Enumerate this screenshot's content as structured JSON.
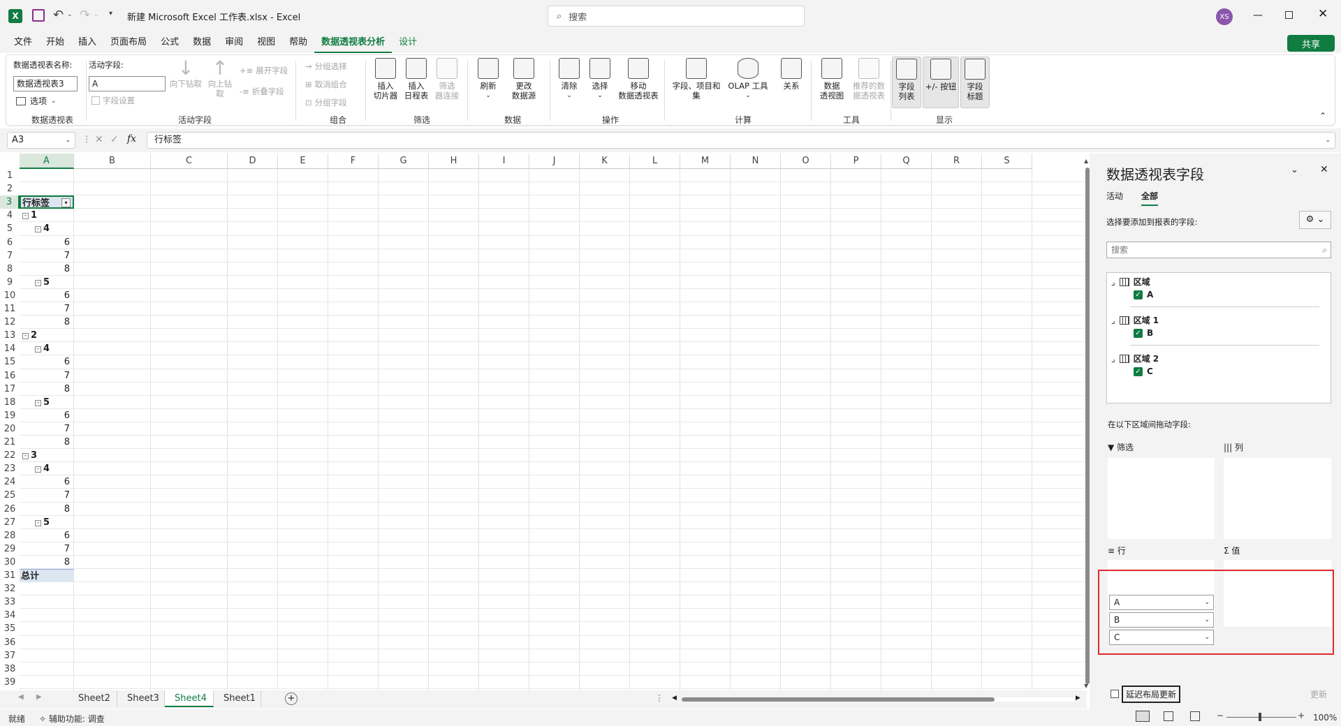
{
  "titlebar": {
    "doc_title": "新建 Microsoft Excel 工作表.xlsx  -  Excel",
    "search_placeholder": "搜索",
    "avatar": "XS"
  },
  "menu": {
    "items": [
      "文件",
      "开始",
      "插入",
      "页面布局",
      "公式",
      "数据",
      "审阅",
      "视图",
      "帮助",
      "数据透视表分析",
      "设计"
    ],
    "active": "数据透视表分析",
    "share": "共享"
  },
  "ribbon": {
    "pt_name_label": "数据透视表名称:",
    "pt_name_value": "数据透视表3",
    "options": "选项",
    "group_pivot": "数据透视表",
    "active_field_label": "活动字段:",
    "active_field_value": "A",
    "field_settings": "字段设置",
    "drill_down": "向下钻取",
    "drill_up": "向上钻\n取",
    "expand_field": "展开字段",
    "collapse_field": "折叠字段",
    "group_active": "活动字段",
    "group_selection": "分组选择",
    "ungroup": "取消组合",
    "group_field": "分组字段",
    "group_group": "组合",
    "insert_slicer": "插入\n切片器",
    "insert_timeline": "插入\n日程表",
    "filter_conn": "筛选\n器连接",
    "group_filter": "筛选",
    "refresh": "刷新",
    "change_source": "更改\n数据源",
    "group_data": "数据",
    "clear": "清除",
    "select": "选择",
    "move_pt": "移动\n数据透视表",
    "group_actions": "操作",
    "fields_items": "字段、项目和\n集",
    "olap": "OLAP 工具",
    "relations": "关系",
    "group_calc": "计算",
    "pivot_chart": "数据\n透视图",
    "recommended": "推荐的数\n据透视表",
    "group_tools": "工具",
    "field_list": "字段\n列表",
    "plus_minus": "+/- 按钮",
    "field_headers": "字段\n标题",
    "group_show": "显示"
  },
  "formula_bar": {
    "name_box": "A3",
    "fx": "fx",
    "content": "行标签"
  },
  "grid": {
    "columns": [
      "A",
      "B",
      "C",
      "D",
      "E",
      "F",
      "G",
      "H",
      "I",
      "J",
      "K",
      "L",
      "M",
      "N",
      "O",
      "P",
      "Q",
      "R",
      "S"
    ],
    "rows": [
      "1",
      "2",
      "3",
      "4",
      "5",
      "6",
      "7",
      "8",
      "9",
      "10",
      "11",
      "12",
      "13",
      "14",
      "15",
      "16",
      "17",
      "18",
      "19",
      "20",
      "21",
      "22",
      "23",
      "24",
      "25",
      "26",
      "27",
      "28",
      "29",
      "30",
      "31",
      "32",
      "33",
      "34",
      "35",
      "36",
      "37",
      "38",
      "39"
    ],
    "header_cell": "行标签",
    "total_cell": "总计",
    "pivot": [
      {
        "row": 4,
        "level": 0,
        "text": "1"
      },
      {
        "row": 5,
        "level": 1,
        "text": "4"
      },
      {
        "row": 6,
        "level": 2,
        "text": "6"
      },
      {
        "row": 7,
        "level": 2,
        "text": "7"
      },
      {
        "row": 8,
        "level": 2,
        "text": "8"
      },
      {
        "row": 9,
        "level": 1,
        "text": "5"
      },
      {
        "row": 10,
        "level": 2,
        "text": "6"
      },
      {
        "row": 11,
        "level": 2,
        "text": "7"
      },
      {
        "row": 12,
        "level": 2,
        "text": "8"
      },
      {
        "row": 13,
        "level": 0,
        "text": "2"
      },
      {
        "row": 14,
        "level": 1,
        "text": "4"
      },
      {
        "row": 15,
        "level": 2,
        "text": "6"
      },
      {
        "row": 16,
        "level": 2,
        "text": "7"
      },
      {
        "row": 17,
        "level": 2,
        "text": "8"
      },
      {
        "row": 18,
        "level": 1,
        "text": "5"
      },
      {
        "row": 19,
        "level": 2,
        "text": "6"
      },
      {
        "row": 20,
        "level": 2,
        "text": "7"
      },
      {
        "row": 21,
        "level": 2,
        "text": "8"
      },
      {
        "row": 22,
        "level": 0,
        "text": "3"
      },
      {
        "row": 23,
        "level": 1,
        "text": "4"
      },
      {
        "row": 24,
        "level": 2,
        "text": "6"
      },
      {
        "row": 25,
        "level": 2,
        "text": "7"
      },
      {
        "row": 26,
        "level": 2,
        "text": "8"
      },
      {
        "row": 27,
        "level": 1,
        "text": "5"
      },
      {
        "row": 28,
        "level": 2,
        "text": "6"
      },
      {
        "row": 29,
        "level": 2,
        "text": "7"
      },
      {
        "row": 30,
        "level": 2,
        "text": "8"
      }
    ]
  },
  "sheets": {
    "tabs": [
      "Sheet2",
      "Sheet3",
      "Sheet4",
      "Sheet1"
    ],
    "active": "Sheet4"
  },
  "status": {
    "ready": "就绪",
    "accessibility": "辅助功能: 调查",
    "zoom": "100%"
  },
  "panel": {
    "title": "数据透视表字段",
    "tab_active_label": "活动",
    "tab_all_label": "全部",
    "choose_label": "选择要添加到报表的字段:",
    "search_placeholder": "搜索",
    "tables": [
      {
        "name": "区域",
        "field": "A"
      },
      {
        "name": "区域 1",
        "field": "B"
      },
      {
        "name": "区域 2",
        "field": "C"
      }
    ],
    "drag_label": "在以下区域间拖动字段:",
    "filter_label": "筛选",
    "columns_label": "列",
    "rows_label": "行",
    "values_label": "值",
    "row_fields": [
      "A",
      "B",
      "C"
    ],
    "defer_label": "延迟布局更新",
    "update_label": "更新"
  },
  "colors": {
    "accent": "#107c41",
    "highlight_border": "#e0282e"
  }
}
